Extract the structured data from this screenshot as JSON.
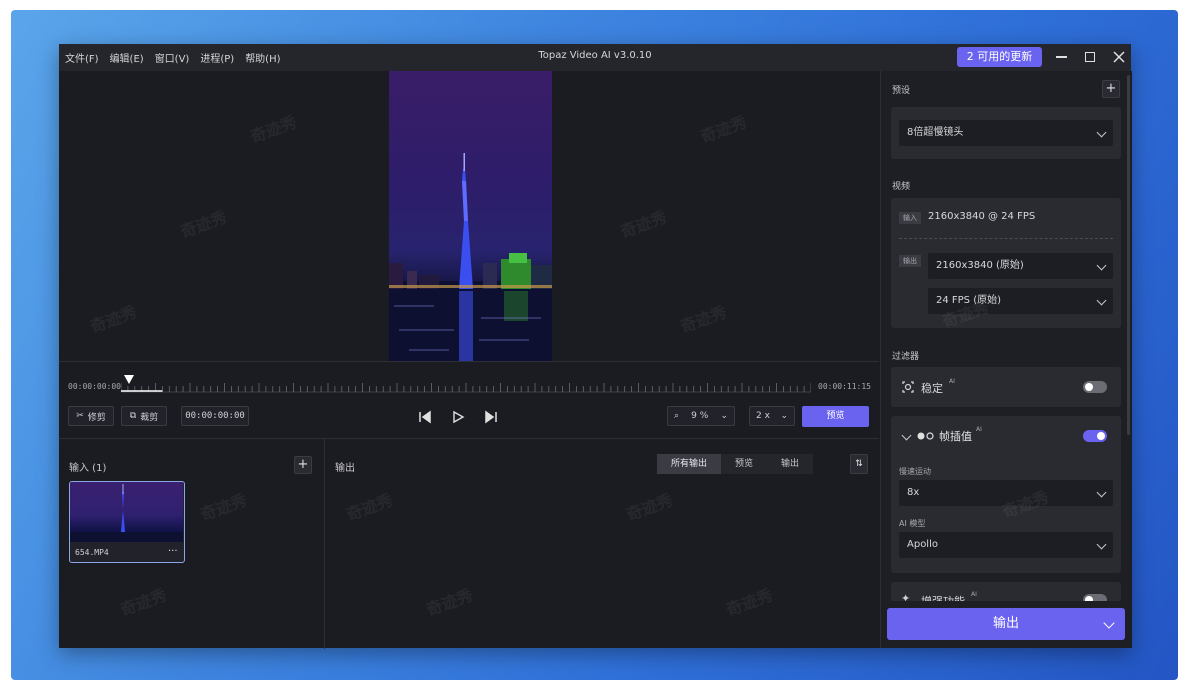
{
  "menu": [
    "文件(F)",
    "编辑(E)",
    "窗口(V)",
    "进程(P)",
    "帮助(H)"
  ],
  "window_title": "Topaz Video AI  v3.0.10",
  "update_button": "2 可用的更新",
  "timeline": {
    "start_time": "00:00:00:00",
    "end_time": "00:00:11:15",
    "progress": 0.06
  },
  "controls": {
    "trim_label": "修剪",
    "crop_label": "裁剪",
    "timecode": "00:00:00:00",
    "zoom_value": "9 %",
    "speed_value": "2 x",
    "preview_label": "预览"
  },
  "input_pane": {
    "title": "输入 (1)",
    "thumb_filename": "654.MP4",
    "thumb_more": "···"
  },
  "output_pane": {
    "title": "输出",
    "tabs": [
      "所有输出",
      "预览",
      "输出"
    ]
  },
  "right_panel": {
    "preset_label": "预设",
    "preset_value": "8倍超慢镜头",
    "video_label": "视频",
    "input_tag": "输入",
    "input_info": "2160x3840 @ 24 FPS",
    "output_tag": "输出",
    "output_resolution": "2160x3840 (原始)",
    "output_fps": "24 FPS (原始)",
    "filters_label": "过滤器",
    "stabilize_label": "稳定",
    "stabilize_ai": "AI",
    "interp_label": "帧插值",
    "interp_ai": "AI",
    "slowmo_label": "慢速运动",
    "slowmo_value": "8x",
    "aimodel_label": "AI 模型",
    "aimodel_value": "Apollo",
    "enhance_label": "增强功能",
    "enhance_ai": "AI",
    "export_label": "输出"
  },
  "watermark": "奇迹秀",
  "colors": {
    "accent": "#6a63f0",
    "bg": "#1b1c21",
    "panel": "#2a2b31"
  }
}
